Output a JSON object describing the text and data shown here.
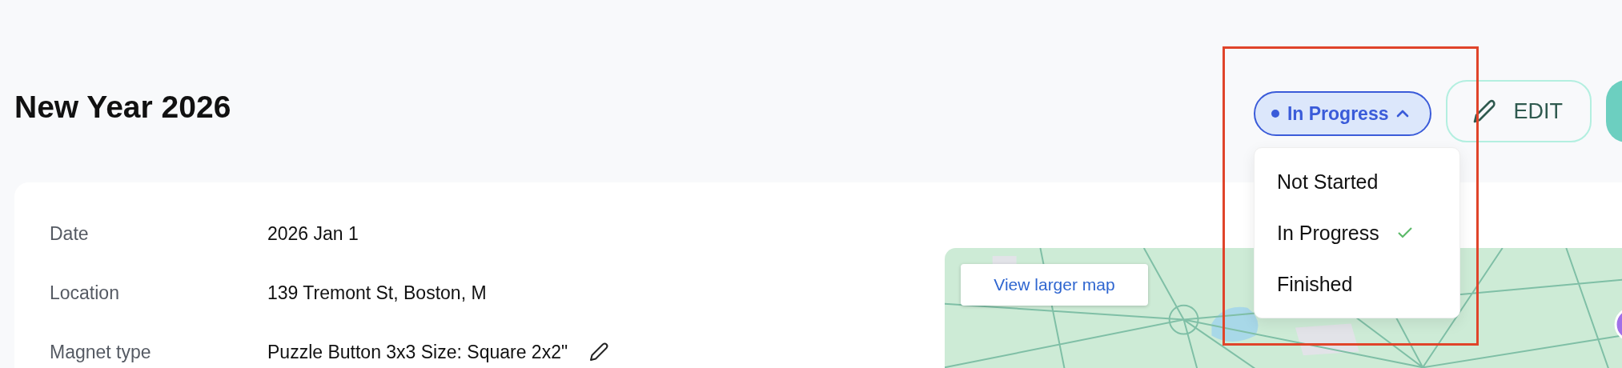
{
  "title": "New Year 2026",
  "status": {
    "label": "In Progress",
    "expanded": true,
    "options": [
      {
        "label": "Not Started",
        "selected": false
      },
      {
        "label": "In Progress",
        "selected": true
      },
      {
        "label": "Finished",
        "selected": false
      }
    ]
  },
  "edit_button": {
    "label": "EDIT"
  },
  "details": [
    {
      "label": "Date",
      "value": "2026 Jan 1",
      "editable": false
    },
    {
      "label": "Location",
      "value": "139 Tremont St, Boston, M",
      "editable": false
    },
    {
      "label": "Magnet type",
      "value": "Puzzle Button 3x3 Size: Square 2x2\"",
      "editable": true
    }
  ],
  "map": {
    "button": "View larger map"
  }
}
